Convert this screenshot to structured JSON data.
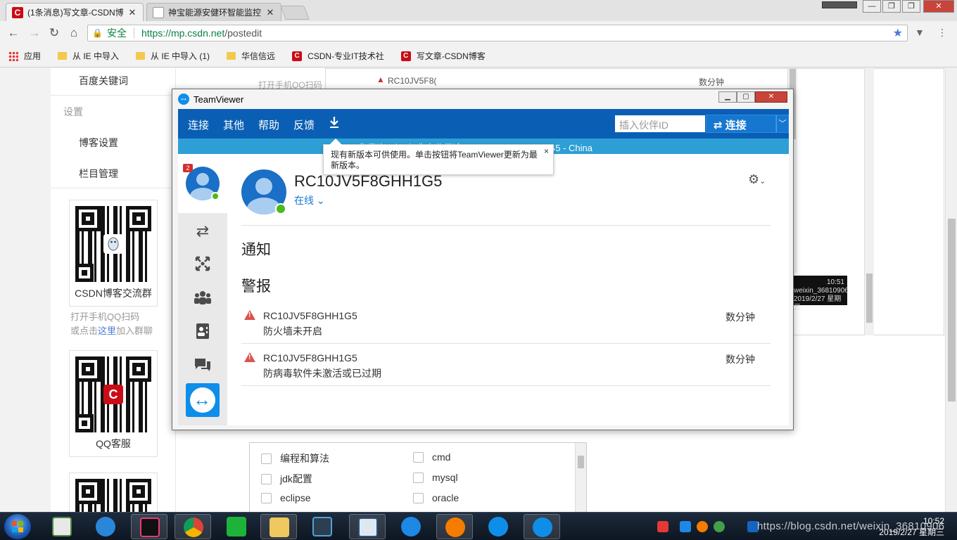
{
  "browser": {
    "tabs": [
      {
        "title": "(1条消息)写文章-CSDN博",
        "close": "✕",
        "active": true
      },
      {
        "title": "神宝能源安健环智能监控",
        "close": "✕",
        "active": false
      }
    ],
    "window_controls": {
      "minimize": "—",
      "maximize": "❐",
      "close": "✕"
    },
    "security_label": "安全",
    "url_host": "https://mp.csdn.net",
    "url_path": "/postedit",
    "bookmarks": [
      {
        "label": "应用",
        "icon": "apps-grid-icon"
      },
      {
        "label": "从 IE 中导入",
        "icon": "folder-icon"
      },
      {
        "label": "从 IE 中导入 (1)",
        "icon": "folder-icon"
      },
      {
        "label": "华信信远",
        "icon": "folder-icon"
      },
      {
        "label": "CSDN-专业IT技术社",
        "icon": "csdn-icon"
      },
      {
        "label": "写文章-CSDN博客",
        "icon": "csdn-icon"
      }
    ]
  },
  "csdn": {
    "nav": {
      "baidu_keywords": "百度关键词",
      "settings_head": "设置",
      "blog_settings": "博客设置",
      "column_management": "栏目管理"
    },
    "qr_cards": [
      {
        "caption": "CSDN博客交流群"
      },
      {
        "caption": "QQ客服"
      }
    ],
    "help": {
      "line1": "打开手机QQ扫码",
      "line2_prefix": "或点击",
      "line2_link": "这里",
      "line2_suffix": "加入群聊"
    },
    "background": {
      "scan_text": "打开手机QQ扫码",
      "alert_id_short": "RC10JV5F8(",
      "time_label": "数分钟",
      "dark_time": "10:51",
      "dark_user": "weixin_36810906",
      "dark_date": "2019/2/27 星期三"
    },
    "tags": [
      {
        "label": "编程和算法"
      },
      {
        "label": "cmd"
      },
      {
        "label": "jdk配置"
      },
      {
        "label": "mysql"
      },
      {
        "label": "eclipse"
      },
      {
        "label": "oracle"
      }
    ]
  },
  "teamviewer": {
    "title": "TeamViewer",
    "menu": {
      "connect": "连接",
      "other": "其他",
      "help": "帮助",
      "feedback": "反馈"
    },
    "partner_placeholder": "插入伙伴ID",
    "connect_button": "连接",
    "id_bar_text": "免费许可证(仅非商业用途) - RC10JV5F8GHH1G5 - China",
    "tooltip": {
      "text": "现有新版本可供使用。单击按钮将TeamViewer更新为最新版本。",
      "close": "×"
    },
    "badge_count": "2",
    "user": {
      "name": "RC10JV5F8GHH1G5",
      "status": "在线"
    },
    "notifications_heading": "通知",
    "alerts_heading": "警报",
    "alerts": [
      {
        "id": "RC10JV5F8GHH1G5",
        "message": "防火墙未开启",
        "time": "数分钟"
      },
      {
        "id": "RC10JV5F8GHH1G5",
        "message": "防病毒软件未激活或已过期",
        "time": "数分钟"
      }
    ]
  },
  "taskbar": {
    "clock_time": "10:52",
    "clock_date": "2019/2/27 星期三",
    "watermark": "https://blog.csdn.net/weixin_36810906"
  },
  "colors": {
    "tv_blue": "#0a5fb4",
    "tv_id_bar": "#2d9fd6",
    "csdn_red": "#ca0c16",
    "secure_green": "#0b8043",
    "warning_red": "#d9534f"
  }
}
